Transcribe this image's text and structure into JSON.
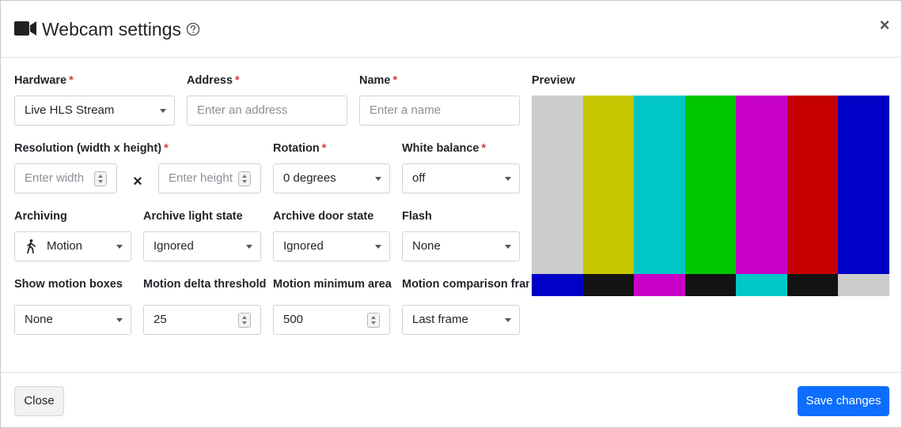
{
  "header": {
    "title": "Webcam settings",
    "close_glyph": "×",
    "icons": {
      "camera": "video-camera-icon",
      "help": "help-circle-icon"
    }
  },
  "form": {
    "required_mark": "*",
    "times_glyph": "×",
    "hardware": {
      "label": "Hardware",
      "value": "Live HLS Stream"
    },
    "address": {
      "label": "Address",
      "placeholder": "Enter an address"
    },
    "name": {
      "label": "Name",
      "placeholder": "Enter a name"
    },
    "resolution": {
      "label": "Resolution (width x height)",
      "width_placeholder": "Enter width",
      "height_placeholder": "Enter height"
    },
    "rotation": {
      "label": "Rotation",
      "value": "0 degrees"
    },
    "white_balance": {
      "label": "White balance",
      "value": "off"
    },
    "archiving": {
      "label": "Archiving",
      "value": "Motion",
      "icon": "walking-person-icon"
    },
    "archive_light_state": {
      "label": "Archive light state",
      "value": "Ignored"
    },
    "archive_door_state": {
      "label": "Archive door state",
      "value": "Ignored"
    },
    "flash": {
      "label": "Flash",
      "value": "None"
    },
    "show_motion_boxes": {
      "label": "Show motion boxes",
      "value": "None"
    },
    "motion_delta_threshold": {
      "label": "Motion delta threshold",
      "value": "25"
    },
    "motion_minimum_area": {
      "label": "Motion minimum area",
      "value": "500"
    },
    "motion_comparison_frame": {
      "label": "Motion comparison frame",
      "value": "Last frame"
    }
  },
  "preview": {
    "label": "Preview",
    "top_colors": [
      "#cccccc",
      "#c6c600",
      "#00c6c6",
      "#00c600",
      "#c600c6",
      "#c60000",
      "#0000c6"
    ],
    "bottom_colors": [
      "#0000c6",
      "#131313",
      "#c600c6",
      "#131313",
      "#00c6c6",
      "#131313",
      "#cccccc"
    ]
  },
  "footer": {
    "close_label": "Close",
    "save_label": "Save changes"
  },
  "colors": {
    "primary": "#0d6efd",
    "required": "#dc3545"
  }
}
